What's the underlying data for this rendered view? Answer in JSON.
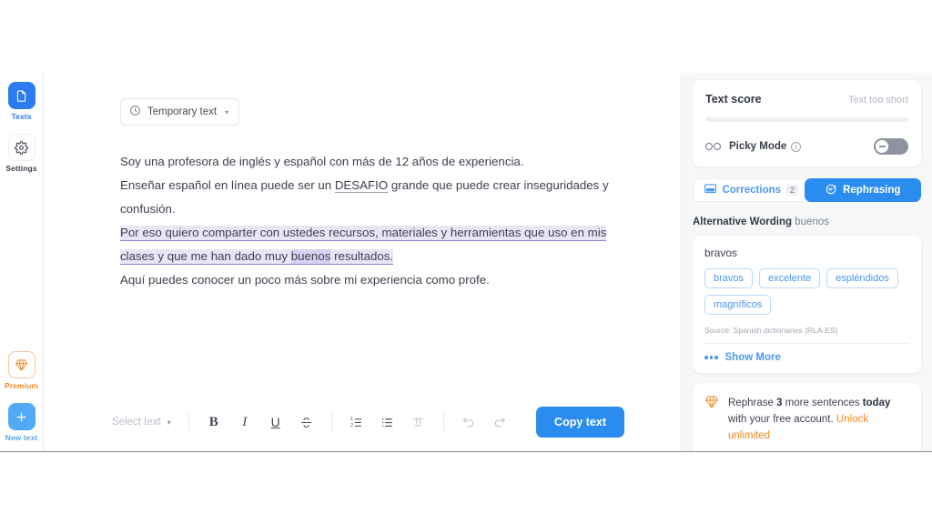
{
  "sidebar": {
    "items": [
      {
        "label": "Texts",
        "icon": "document-icon",
        "state": "active"
      },
      {
        "label": "Settings",
        "icon": "gear-icon",
        "state": "default"
      }
    ],
    "bottom": [
      {
        "label": "Premium",
        "icon": "diamond-icon",
        "state": "premium"
      },
      {
        "label": "New text",
        "icon": "plus-icon",
        "state": "newtext"
      }
    ]
  },
  "editor": {
    "temporary_chip": {
      "label": "Temporary text",
      "icon": "clock-icon",
      "chevron": "⌄"
    },
    "paragraphs": [
      {
        "segments": [
          {
            "text": "Soy una profesora de inglés y español con más de 12 años de experiencia.",
            "style": "plain"
          }
        ]
      },
      {
        "segments": [
          {
            "text": "Enseñar español en línea puede ser un ",
            "style": "plain"
          },
          {
            "text": "DESAFIO",
            "style": "underline"
          },
          {
            "text": " grande que puede crear inseguridades y confusión.",
            "style": "plain"
          }
        ]
      },
      {
        "segments": [
          {
            "text": "Por eso quiero comparter con ustedes recursos, materiales  y herramientas que uso en mis clases y que me han dado muy ",
            "style": "highlight"
          },
          {
            "text": "buenos",
            "style": "highlight-word"
          },
          {
            "text": " resultados.",
            "style": "highlight"
          }
        ]
      },
      {
        "segments": [
          {
            "text": "Aquí puedes conocer un poco más sobre mi experiencia como profe.",
            "style": "plain"
          }
        ]
      }
    ]
  },
  "toolbar": {
    "select_text": {
      "label": "Select text",
      "chevron": "⌄"
    },
    "buttons": [
      {
        "name": "bold",
        "glyph": "B"
      },
      {
        "name": "italic",
        "glyph": "I"
      },
      {
        "name": "underline",
        "glyph": "U"
      },
      {
        "name": "strikethrough",
        "glyph": "S"
      },
      {
        "name": "numbered-list",
        "glyph": "1."
      },
      {
        "name": "bullet-list",
        "glyph": "≡"
      },
      {
        "name": "clear-format",
        "glyph": "T"
      },
      {
        "name": "undo",
        "glyph": "↶"
      },
      {
        "name": "redo",
        "glyph": "↷"
      }
    ],
    "copy_label": "Copy text"
  },
  "right_panel": {
    "score": {
      "title": "Text score",
      "status": "Text too short",
      "picky_label": "Picky Mode",
      "picky_info": "i",
      "picky_enabled": false
    },
    "tabs": [
      {
        "label": "Corrections",
        "badge": "2",
        "icon": "corrections-icon",
        "active": false
      },
      {
        "label": "Rephrasing",
        "badge": "",
        "icon": "rephrase-icon",
        "active": true
      }
    ],
    "alternative": {
      "heading": "Alternative Wording",
      "target_word": "buenos",
      "base_word": "bravos",
      "synonyms": [
        "bravos",
        "excelente",
        "espléndidos",
        "magníficos"
      ],
      "source_label": "Source:",
      "source_value": "Spanish dictionaries (RLA-ES)",
      "show_more": "Show More"
    },
    "promo": {
      "icon": "diamond-icon",
      "line1_a": "Rephrase ",
      "line1_count": "3",
      "line1_b": " more sentences ",
      "line1_today": "today",
      "line2_a": "with your free account. ",
      "link": "Unlock unlimited"
    }
  },
  "colors": {
    "accent_blue": "#2b8cf0",
    "light_blue": "#52a9f5",
    "premium_orange": "#f08a24",
    "highlight_lavender": "#e8e5f7",
    "panel_bg": "#f6f7f9"
  }
}
